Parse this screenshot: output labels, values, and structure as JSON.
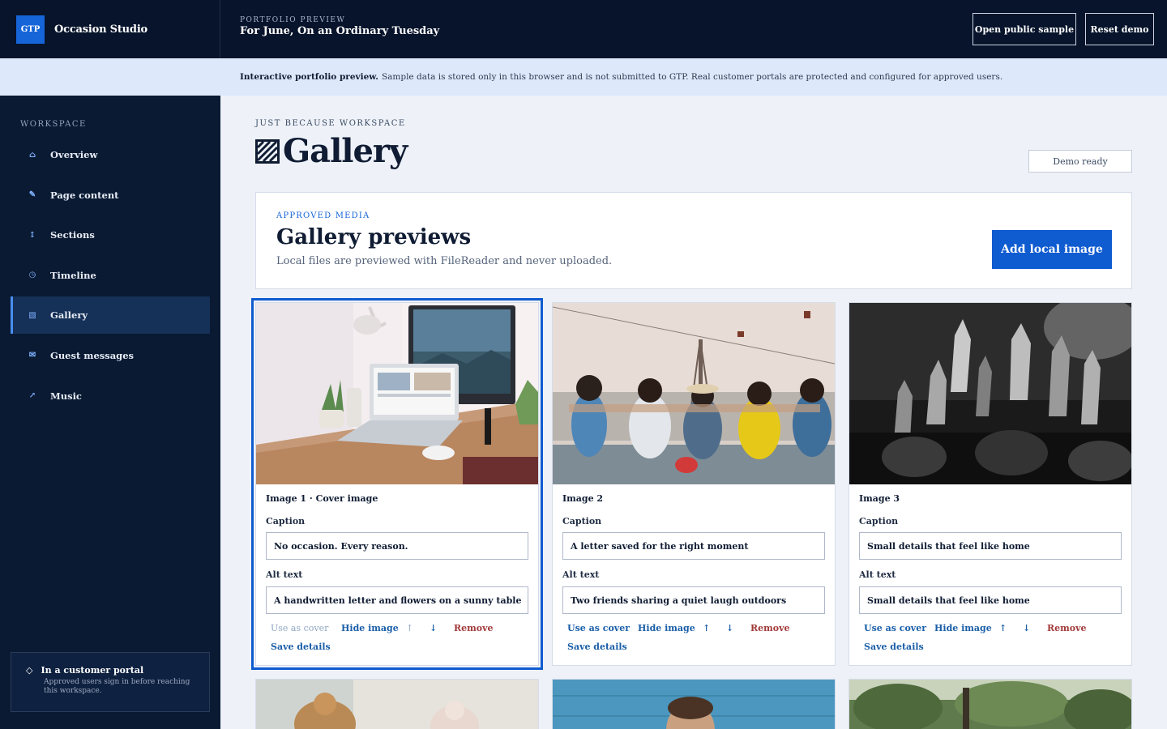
{
  "brand": {
    "logo": "GTP",
    "name": "Occasion Studio"
  },
  "header": {
    "eyebrow": "PORTFOLIO PREVIEW",
    "title": "For June, On an Ordinary Tuesday",
    "open_sample_label": "Open public sample",
    "reset_label": "Reset demo"
  },
  "banner": {
    "bold": "Interactive portfolio preview.",
    "text": "Sample data is stored only in this browser and is not submitted to GTP. Real customer portals are protected and configured for approved users."
  },
  "sidebar": {
    "section_label": "WORKSPACE",
    "items": [
      {
        "label": "Overview",
        "icon": "home-icon",
        "glyph": "⌂"
      },
      {
        "label": "Page content",
        "icon": "pencil-icon",
        "glyph": "✎"
      },
      {
        "label": "Sections",
        "icon": "arrows-vertical-icon",
        "glyph": "↕"
      },
      {
        "label": "Timeline",
        "icon": "clock-icon",
        "glyph": "◷"
      },
      {
        "label": "Gallery",
        "icon": "gallery-icon",
        "glyph": "▧"
      },
      {
        "label": "Guest messages",
        "icon": "envelope-icon",
        "glyph": "✉"
      },
      {
        "label": "Music",
        "icon": "arrow-up-right-icon",
        "glyph": "↗"
      }
    ],
    "active_index": 4,
    "portal": {
      "title": "In a customer portal",
      "subtitle": "Approved users sign in before reaching this workspace."
    }
  },
  "main": {
    "eyebrow": "JUST BECAUSE WORKSPACE",
    "title": "Gallery",
    "status": "Demo ready",
    "media_panel": {
      "eyebrow": "APPROVED MEDIA",
      "title": "Gallery previews",
      "description": "Local files are previewed with FileReader and never uploaded.",
      "add_label": "Add local image"
    },
    "field_labels": {
      "caption": "Caption",
      "alt": "Alt text"
    },
    "action_labels": {
      "cover": "Use as cover",
      "hide": "Hide image",
      "up": "↑",
      "down": "↓",
      "remove": "Remove",
      "save": "Save details"
    },
    "cards": [
      {
        "label": "Image 1 · Cover image",
        "caption": "No occasion. Every reason.",
        "alt": "A handwritten letter and flowers on a sunny table",
        "is_cover": true
      },
      {
        "label": "Image 2",
        "caption": "A letter saved for the right moment",
        "alt": "Two friends sharing a quiet laugh outdoors",
        "is_cover": false
      },
      {
        "label": "Image 3",
        "caption": "Small details that feel like home",
        "alt": "Small details that feel like home",
        "is_cover": false
      }
    ]
  },
  "colors": {
    "navy": "#07142b",
    "accent": "#0f5bd0",
    "remove": "#a23a3a",
    "link": "#1a5ea8"
  }
}
